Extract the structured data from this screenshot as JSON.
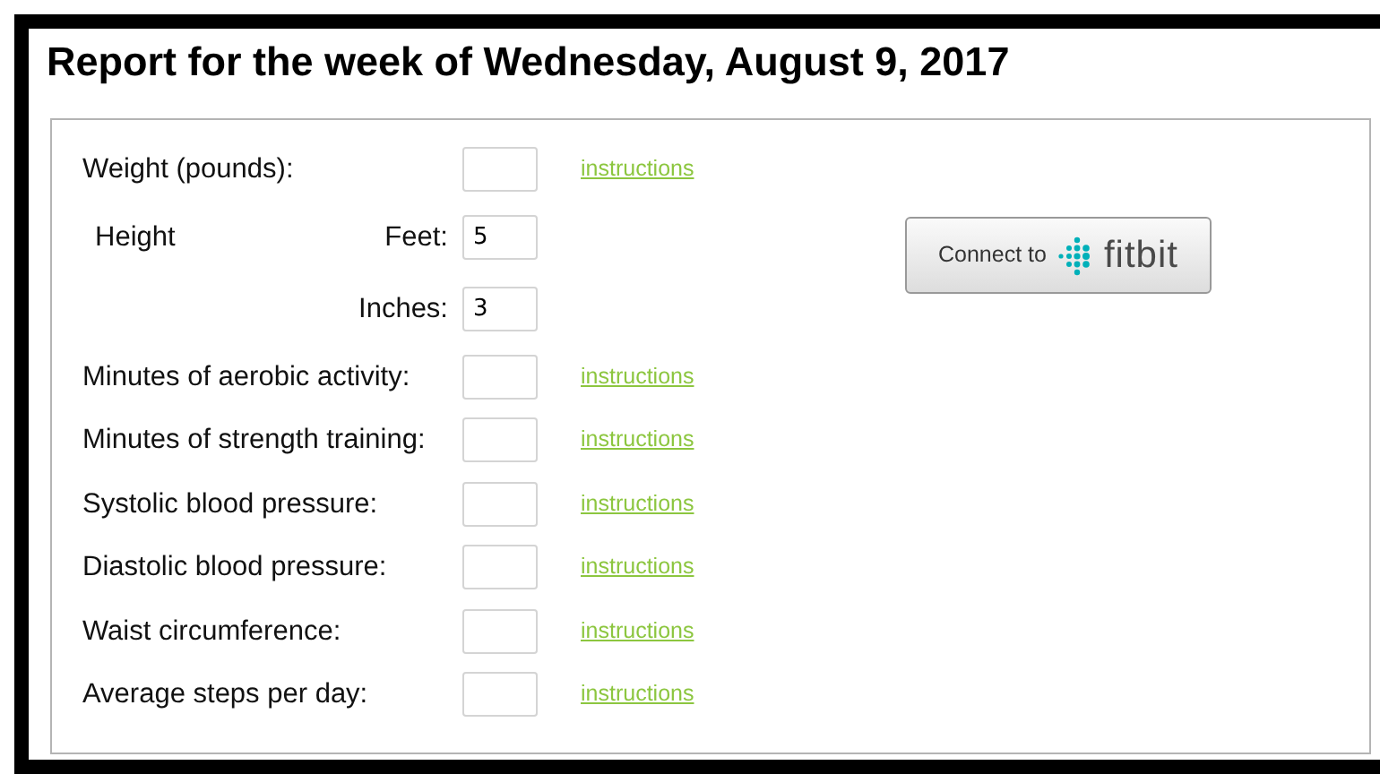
{
  "title": "Report for the week of Wednesday, August 9, 2017",
  "rows": [
    {
      "kind": "field",
      "label": "Weight (pounds):",
      "link": "instructions"
    },
    {
      "kind": "height",
      "label": "Height",
      "parts": [
        {
          "label": "Feet:",
          "value": "5"
        },
        {
          "label": "Inches:",
          "value": "3"
        }
      ]
    },
    {
      "kind": "field",
      "label": "Minutes of aerobic activity:",
      "link": "instructions"
    },
    {
      "kind": "field",
      "label": "Minutes of strength training:",
      "link": "instructions"
    },
    {
      "kind": "field",
      "label": "Systolic blood pressure:",
      "link": "instructions"
    },
    {
      "kind": "field",
      "label": "Diastolic blood pressure:",
      "link": "instructions"
    },
    {
      "kind": "field",
      "label": "Waist circumference:",
      "link": "instructions"
    },
    {
      "kind": "field",
      "label": "Average steps per day:",
      "link": "instructions"
    }
  ],
  "connect_button": {
    "prefix": "Connect to",
    "brand": "fitbit"
  }
}
